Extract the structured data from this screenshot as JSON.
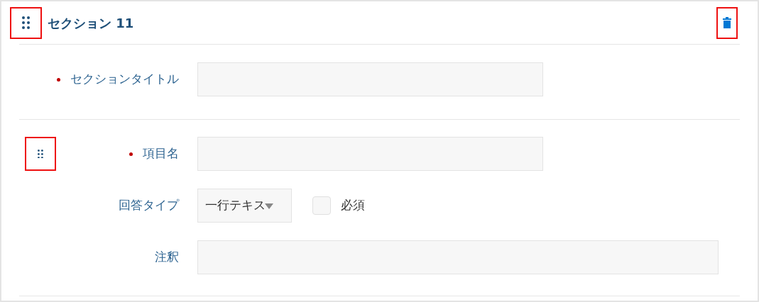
{
  "section": {
    "title": "セクション 11",
    "highlighted_controls": true
  },
  "title_field": {
    "label": "セクションタイトル",
    "required": true
  },
  "item": {
    "fields": [
      {
        "kind": "text",
        "label": "項目名",
        "required": true
      },
      {
        "kind": "select",
        "label": "回答タイプ",
        "required": false,
        "value": "一行テキス",
        "checkbox": {
          "label": "必須",
          "checked": false
        }
      },
      {
        "kind": "wide",
        "label": "注釈",
        "required": false
      }
    ]
  }
}
